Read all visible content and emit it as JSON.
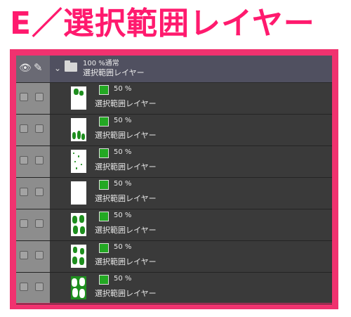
{
  "title": "E／選択範囲レイヤー",
  "colors": {
    "accent": "#f0326f",
    "title": "#ff1a6e",
    "panel": "#3a3a3a",
    "swatch": "#23a823"
  },
  "header": {
    "icons": [
      "eye-icon",
      "pen-icon",
      "chevron-down-icon",
      "folder-icon"
    ],
    "line1": "100 %通常",
    "line2": "選択範囲レイヤー"
  },
  "layers": [
    {
      "opacity": "50 %",
      "name": "選択範囲レイヤー",
      "pattern": "a"
    },
    {
      "opacity": "50 %",
      "name": "選択範囲レイヤー",
      "pattern": "b"
    },
    {
      "opacity": "50 %",
      "name": "選択範囲レイヤー",
      "pattern": "c"
    },
    {
      "opacity": "50 %",
      "name": "選択範囲レイヤー",
      "pattern": "d"
    },
    {
      "opacity": "50 %",
      "name": "選択範囲レイヤー",
      "pattern": "e"
    },
    {
      "opacity": "50 %",
      "name": "選択範囲レイヤー",
      "pattern": "f"
    },
    {
      "opacity": "50 %",
      "name": "選択範囲レイヤー",
      "pattern": "g"
    }
  ]
}
